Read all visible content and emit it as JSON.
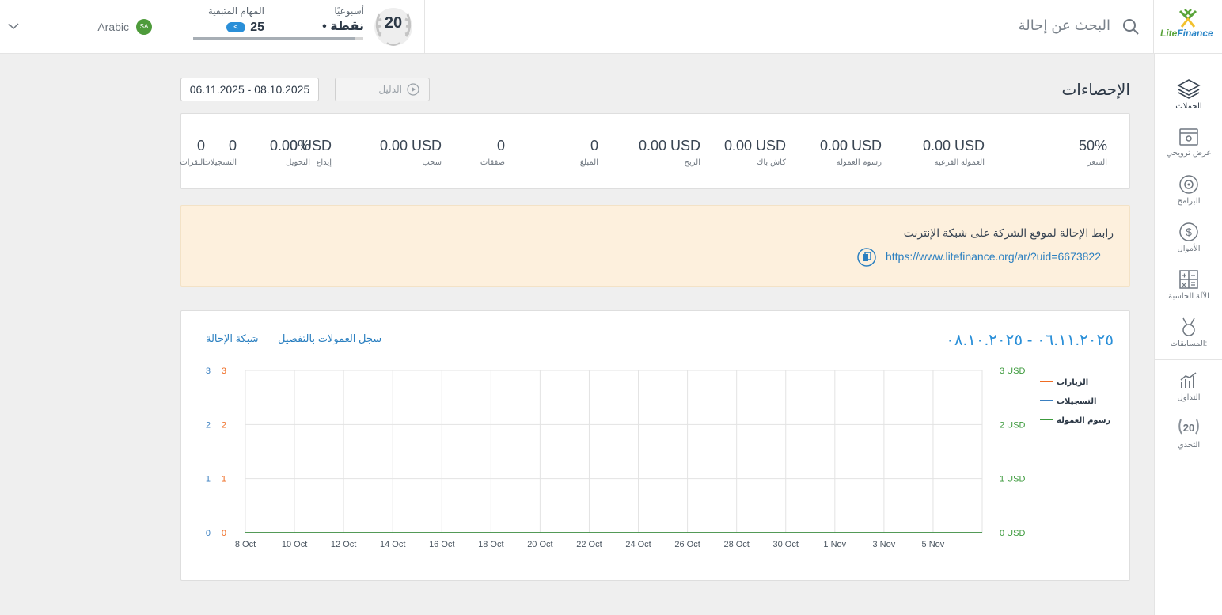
{
  "header": {
    "logo": {
      "brand_a": "Lite",
      "brand_b": "Finance"
    },
    "search": {
      "text": "البحث عن إحالة",
      "icon": "search-icon"
    },
    "challenge": {
      "number": "20",
      "weekly_label": "أسبوعيًا",
      "weekly_value": "• نقطة"
    },
    "tasks": {
      "label": "المهام المتبقية",
      "value": "25",
      "button": "<",
      "progress": 0.95
    },
    "language": {
      "label": "Arabic",
      "flag": "SA"
    }
  },
  "sidebar": {
    "items": [
      {
        "label": "الحملات",
        "icon": "layers-icon",
        "active": true
      },
      {
        "label": "عرض ترويجي",
        "icon": "promo-icon"
      },
      {
        "label": "البرامج",
        "icon": "target-icon"
      },
      {
        "label": "الأموال",
        "icon": "dollar-icon"
      },
      {
        "label": "الآلة الحاسبة",
        "icon": "calculator-icon"
      },
      {
        "label": "المسابقات:",
        "icon": "medal-icon"
      },
      {
        "label": "التداول",
        "icon": "chart-icon"
      },
      {
        "label": "التحدي",
        "icon": "challenge-20-icon"
      }
    ]
  },
  "page": {
    "title": "الإحصاءات",
    "guide_label": "الدليل",
    "date_range": "06.11.2025 - 08.10.2025"
  },
  "stats": [
    {
      "value": "0",
      "label": "النقرات"
    },
    {
      "value": "0",
      "label": "التسجيلات"
    },
    {
      "value": "0%",
      "label": "التحويل"
    },
    {
      "value": "0.00 USD",
      "label": "إيداع"
    },
    {
      "value": "0.00 USD",
      "label": "سحب"
    },
    {
      "value": "0",
      "label": "صفقات"
    },
    {
      "value": "0",
      "label": "المبلغ"
    },
    {
      "value": "0.00 USD",
      "label": "الربح"
    },
    {
      "value": "0.00 USD",
      "label": "كاش باك"
    },
    {
      "value": "0.00 USD",
      "label": "رسوم العمولة"
    },
    {
      "value": "0.00 USD",
      "label": "العمولة الفرعية"
    },
    {
      "value": "50%",
      "label": "السعر"
    }
  ],
  "referral": {
    "title": "رابط الإحالة لموقع الشركة على شبكة الإنترنت",
    "url": "https://www.litefinance.org/ar/?uid=6673822"
  },
  "chart_card": {
    "range_title": "٠٦.١١.٢٠٢٥ - ٠٨.١٠.٢٠٢٥",
    "link_commissions": "سجل العمولات بالتفصيل",
    "link_network": "شبكة الإحالة"
  },
  "chart_data": {
    "type": "line",
    "x": [
      "8 Oct",
      "10 Oct",
      "12 Oct",
      "14 Oct",
      "16 Oct",
      "18 Oct",
      "20 Oct",
      "22 Oct",
      "24 Oct",
      "26 Oct",
      "28 Oct",
      "30 Oct",
      "1 Nov",
      "3 Nov",
      "5 Nov"
    ],
    "x_days": 30,
    "series": [
      {
        "name": "الزيارات",
        "color": "#ef6c23",
        "axis": "left-orange",
        "values": [
          0,
          0
        ]
      },
      {
        "name": "التسجيلات",
        "color": "#3a7fc0",
        "axis": "left-blue",
        "values": [
          0,
          0
        ]
      },
      {
        "name": "رسوم العمولة",
        "color": "#3c9a3c",
        "axis": "right-green",
        "values": [
          0,
          0
        ]
      }
    ],
    "y_left_blue": {
      "ticks": [
        "3",
        "2",
        "1",
        "0"
      ],
      "color": "#3a7fc0"
    },
    "y_left_orange": {
      "ticks": [
        "3",
        "2",
        "1",
        "0"
      ],
      "color": "#ef6c23"
    },
    "y_right": {
      "ticks": [
        "3 USD",
        "2 USD",
        "1 USD",
        "0 USD"
      ],
      "color": "#3c9a3c"
    },
    "ylim": [
      0,
      3
    ],
    "grid": true,
    "legend": "right"
  }
}
